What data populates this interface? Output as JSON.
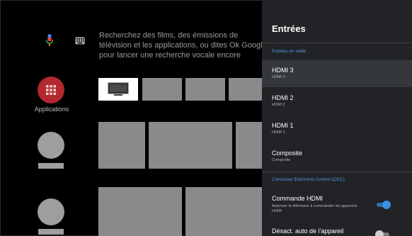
{
  "home": {
    "search_placeholder": "Recherchez des films, des émissions de télévision et les applications, ou dites Ok Google pour lancer une recherche vocale encore",
    "apps_label": "Applications"
  },
  "panel": {
    "title": "Entrées",
    "standby_header": "Entrées en veille",
    "inputs": [
      {
        "title": "HDMI 3",
        "subtitle": "HDMI 3",
        "selected": true
      },
      {
        "title": "HDMI 2",
        "subtitle": "HDMI 2",
        "selected": false
      },
      {
        "title": "HDMI 1",
        "subtitle": "HDMI 1",
        "selected": false
      },
      {
        "title": "Composite",
        "subtitle": "Composite",
        "selected": false
      }
    ],
    "cec_header": "Consumer Electronic Control (CEC)",
    "cec_items": [
      {
        "title": "Commande HDMI",
        "subtitle": "Autoriser le téléviseur à commander les appareils HDMI",
        "toggle_on": true
      },
      {
        "title": "Désact. auto de l'appareil",
        "subtitle": "",
        "toggle_on": false
      }
    ]
  },
  "colors": {
    "accent": "#3e8ee6",
    "apps_circle": "#b3272f",
    "panel_bg": "#212326",
    "selected_row": "#34373b"
  }
}
